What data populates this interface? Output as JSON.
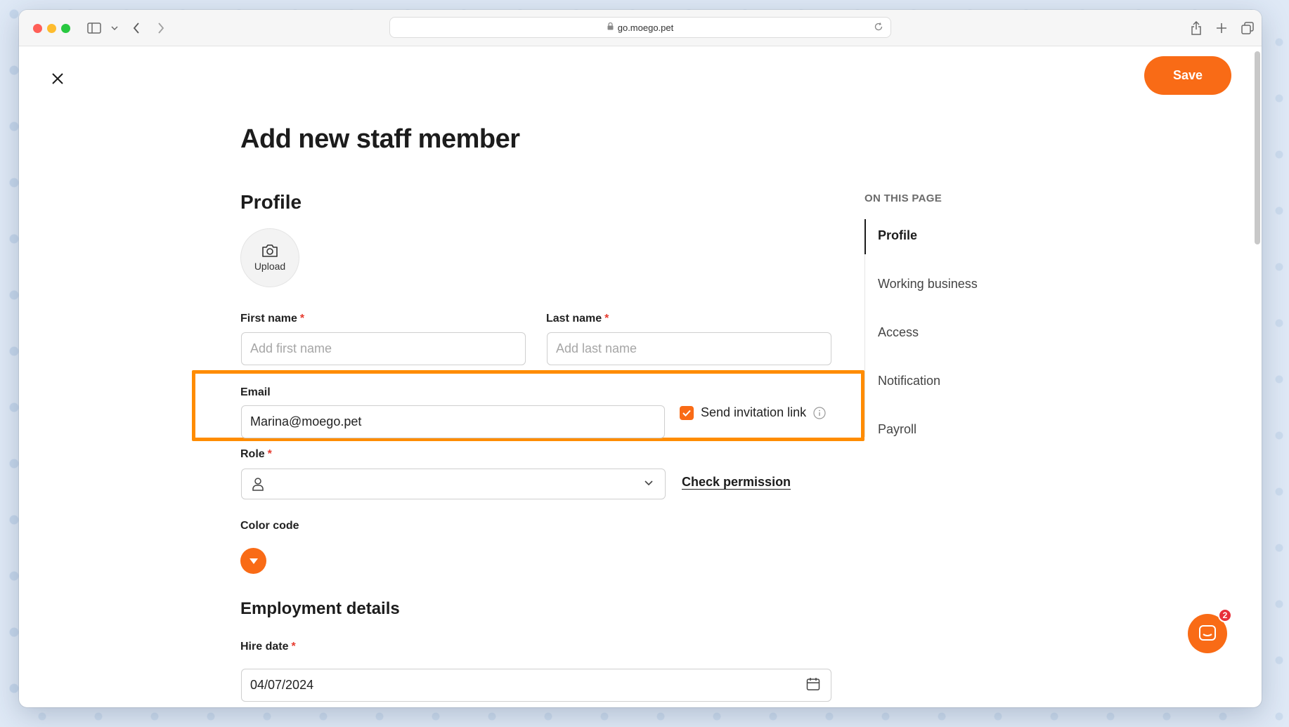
{
  "browser": {
    "url": "go.moego.pet"
  },
  "header": {
    "save_label": "Save"
  },
  "page": {
    "title": "Add new staff member"
  },
  "profile": {
    "title": "Profile",
    "upload_label": "Upload",
    "first_name": {
      "label": "First name",
      "required_mark": "*",
      "placeholder": "Add first name",
      "value": ""
    },
    "last_name": {
      "label": "Last name",
      "required_mark": "*",
      "placeholder": "Add last name",
      "value": ""
    },
    "email": {
      "label": "Email",
      "value": "Marina@moego.pet"
    },
    "send_invitation": {
      "label": "Send invitation link",
      "checked": true
    },
    "role": {
      "label": "Role",
      "required_mark": "*",
      "value": ""
    },
    "check_permission_label": "Check permission",
    "color_code": {
      "label": "Color code",
      "color": "#f96b16"
    }
  },
  "employment": {
    "title": "Employment details",
    "hire_date": {
      "label": "Hire date",
      "required_mark": "*",
      "value": "04/07/2024"
    }
  },
  "toc": {
    "heading": "ON THIS PAGE",
    "items": [
      {
        "label": "Profile",
        "active": true
      },
      {
        "label": "Working business",
        "active": false
      },
      {
        "label": "Access",
        "active": false
      },
      {
        "label": "Notification",
        "active": false
      },
      {
        "label": "Payroll",
        "active": false
      }
    ]
  },
  "chat": {
    "badge_count": "2"
  },
  "colors": {
    "accent": "#f96b16",
    "highlight_border": "#ff8c00",
    "required": "#e63b2e",
    "badge": "#e8303a"
  }
}
